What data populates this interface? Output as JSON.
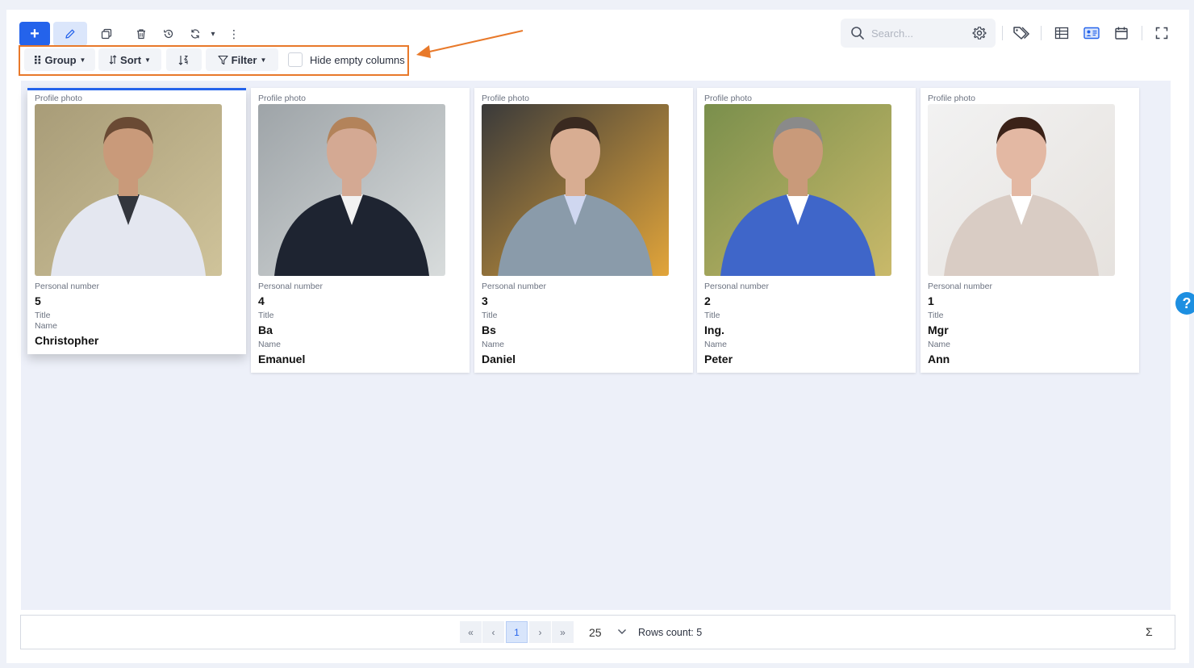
{
  "toolbar": {
    "add_label": "+",
    "more_label": "⋮",
    "caret_label": "▾"
  },
  "search": {
    "placeholder": "Search..."
  },
  "subtoolbar": {
    "group_label": "Group",
    "sort_label": "Sort",
    "filter_label": "Filter",
    "hide_empty_label": "Hide empty columns",
    "hide_empty_checked": false
  },
  "field_labels": {
    "photo": "Profile photo",
    "personal_number": "Personal number",
    "title": "Title",
    "name": "Name"
  },
  "cards": [
    {
      "personal_number": "5",
      "title": "",
      "name": "Christopher",
      "active": true
    },
    {
      "personal_number": "4",
      "title": "Ba",
      "name": "Emanuel",
      "active": false
    },
    {
      "personal_number": "3",
      "title": "Bs",
      "name": "Daniel",
      "active": false
    },
    {
      "personal_number": "2",
      "title": "Ing.",
      "name": "Peter",
      "active": false
    },
    {
      "personal_number": "1",
      "title": "Mgr",
      "name": "Ann",
      "active": false
    }
  ],
  "pagination": {
    "current_page": "1",
    "per_page": "25",
    "rows_count_text": "Rows count: 5",
    "sum_label": "Σ",
    "first_label": "«",
    "prev_label": "‹",
    "next_label": "›",
    "last_label": "»"
  },
  "help_label": "?",
  "colors": {
    "primary": "#2463eb",
    "highlight": "#e8792a",
    "help": "#1d8fe1"
  }
}
